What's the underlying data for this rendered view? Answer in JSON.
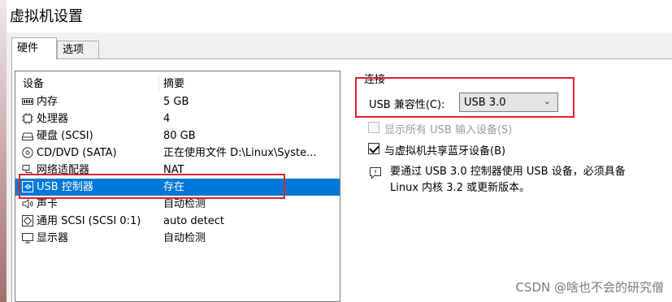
{
  "window": {
    "title": "虚拟机设置"
  },
  "tabs": [
    {
      "label": "硬件",
      "active": true
    },
    {
      "label": "选项",
      "active": false
    }
  ],
  "device_list": {
    "header": {
      "device": "设备",
      "summary": "摘要"
    },
    "rows": [
      {
        "icon": "memory-icon",
        "name": "内存",
        "summary": "5 GB"
      },
      {
        "icon": "processor-icon",
        "name": "处理器",
        "summary": "4"
      },
      {
        "icon": "hard-disk-icon",
        "name": "硬盘 (SCSI)",
        "summary": "80 GB"
      },
      {
        "icon": "cd-dvd-icon",
        "name": "CD/DVD (SATA)",
        "summary": "正在使用文件 D:\\Linux\\Syste..."
      },
      {
        "icon": "network-adapter-icon",
        "name": "网络适配器",
        "summary": "NAT"
      },
      {
        "icon": "usb-icon",
        "name": "USB 控制器",
        "summary": "存在",
        "selected": true
      },
      {
        "icon": "sound-card-icon",
        "name": "声卡",
        "summary": "自动检测"
      },
      {
        "icon": "generic-scsi-icon",
        "name": "通用 SCSI (SCSI 0:1)",
        "summary": "auto detect"
      },
      {
        "icon": "display-icon",
        "name": "显示器",
        "summary": "自动检测"
      }
    ]
  },
  "connection": {
    "section_label": "连接",
    "usb_compat_label": "USB 兼容性(C):",
    "usb_compat_value": "USB 3.0",
    "show_all_usb": {
      "label": "显示所有 USB 输入设备(S)",
      "checked": false,
      "enabled": false
    },
    "share_bluetooth": {
      "label": "与虚拟机共享蓝牙设备(B)",
      "checked": true,
      "enabled": true
    },
    "info_line1": "要通过 USB 3.0 控制器使用 USB 设备，必须具备",
    "info_line2": "Linux 内核 3.2 或更新版本。"
  },
  "watermark": "CSDN @啥也不会的研究僧",
  "colors": {
    "selection": "#0078d7",
    "annotation": "#e0202a"
  }
}
